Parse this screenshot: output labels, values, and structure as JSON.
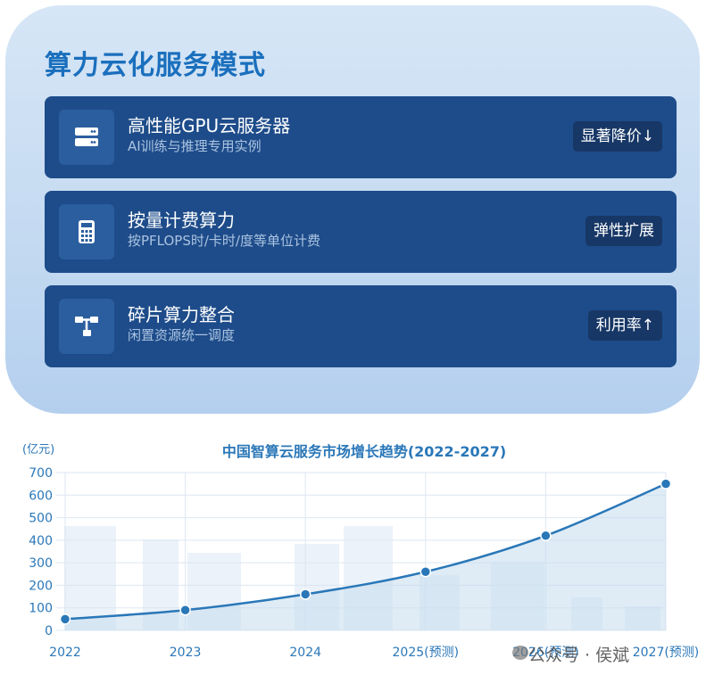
{
  "card": {
    "title": "算力云化服务模式",
    "items": [
      {
        "icon": "server-icon",
        "title": "高性能GPU云服务器",
        "subtitle": "AI训练与推理专用实例",
        "badge": "显著降价↓"
      },
      {
        "icon": "calculator-icon",
        "title": "按量计费算力",
        "subtitle": "按PFLOPS时/卡时/度等单位计费",
        "badge": "弹性扩展"
      },
      {
        "icon": "network-icon",
        "title": "碎片算力整合",
        "subtitle": "闲置资源统一调度",
        "badge": "利用率↑"
      }
    ]
  },
  "colors": {
    "accent": "#1a6fbd",
    "item_bg": "#1e4c8a",
    "line": "#2a77b8",
    "area": "#c4dcef"
  },
  "chart_data": {
    "type": "line",
    "title": "中国智算云服务市场增长趋势(2022-2027)",
    "ylabel": "(亿元)",
    "xlabel": "",
    "categories": [
      "2022",
      "2023",
      "2024",
      "2025(预测)",
      "2026(预测)",
      "2027(预测)"
    ],
    "values": [
      50,
      90,
      160,
      260,
      420,
      650
    ],
    "ylim": [
      0,
      700
    ],
    "yticks": [
      0,
      100,
      200,
      300,
      400,
      500,
      600,
      700
    ],
    "grid": true,
    "area_fill": true
  },
  "watermark": "公众号 · 侯斌"
}
